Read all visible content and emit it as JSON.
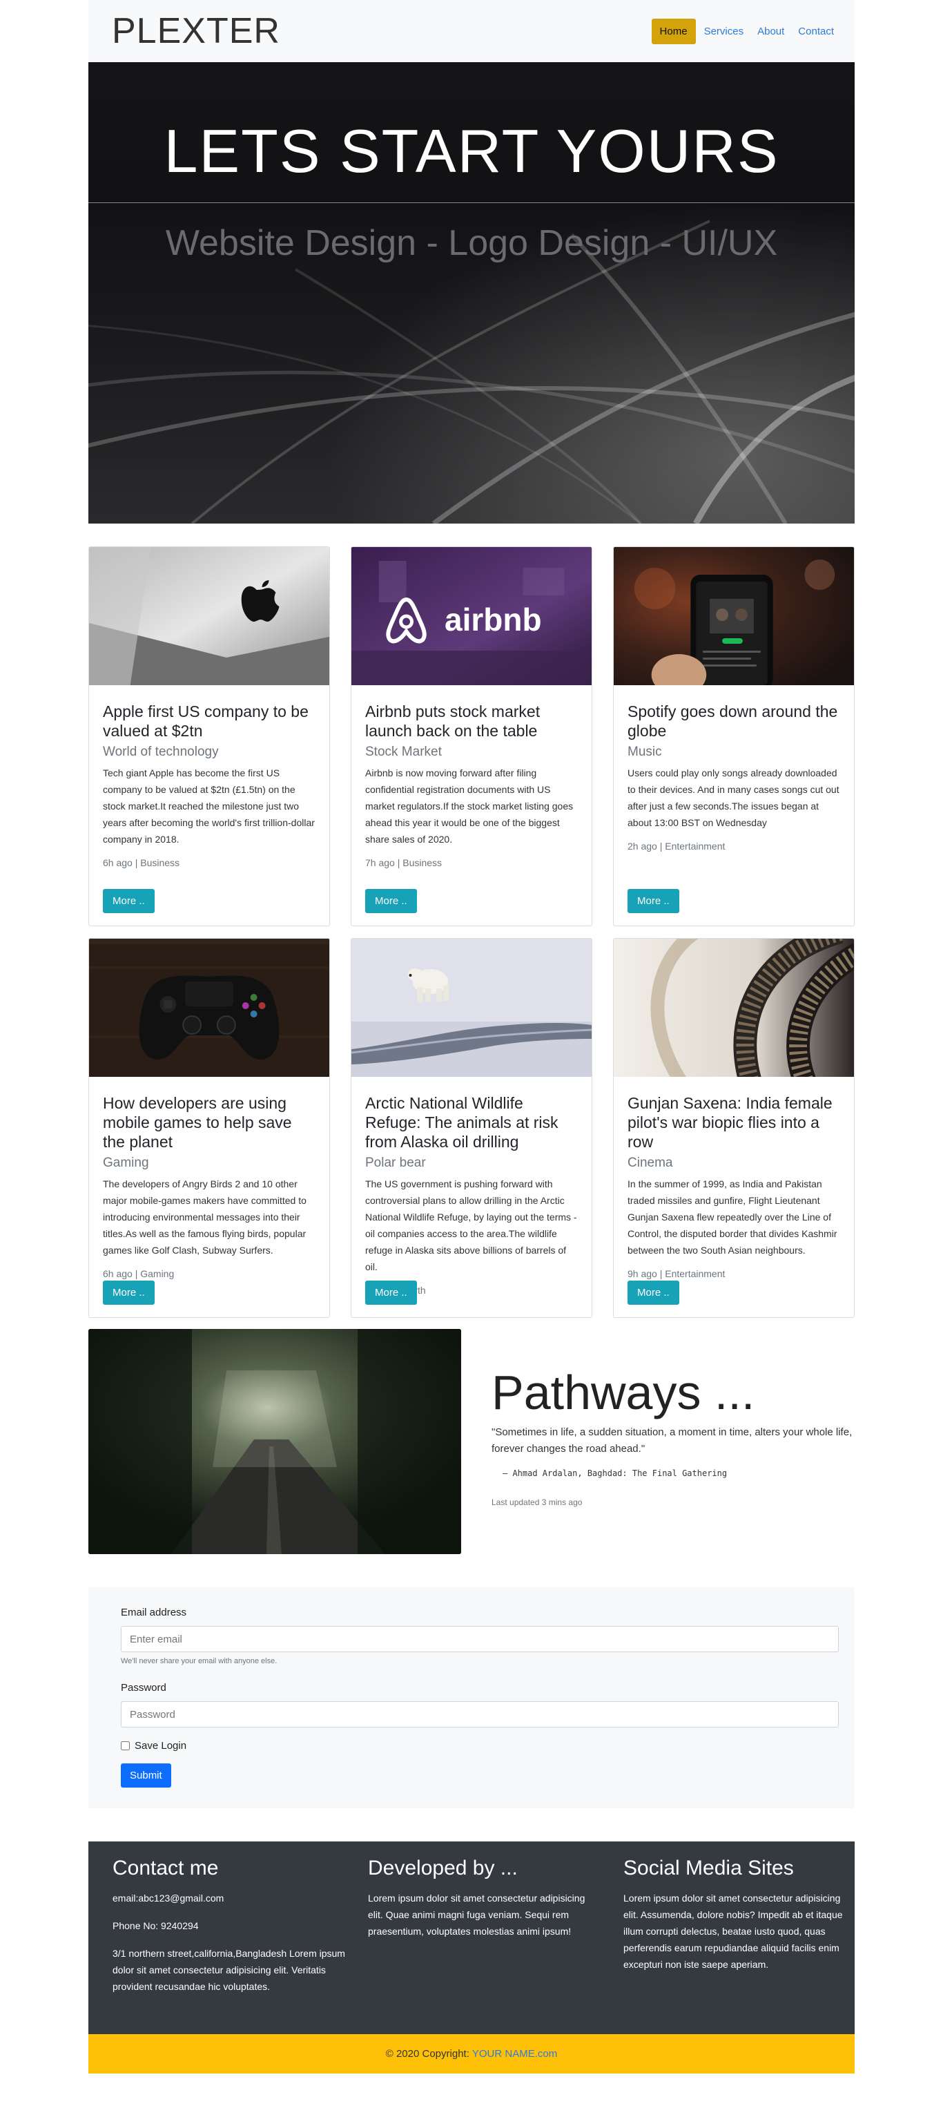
{
  "nav": {
    "brand": "PLEXTER",
    "items": [
      "Home",
      "Services",
      "About",
      "Contact"
    ]
  },
  "hero": {
    "title": "LETS START YOURS",
    "subtitle": "Website Design - Logo Design - UI/UX"
  },
  "cards": [
    {
      "title": "Apple first US company to be valued at $2tn",
      "subtitle": "World of technology",
      "text": "Tech giant Apple has become the first US company to be valued at $2tn (£1.5tn) on the stock market.It reached the milestone just two years after becoming the world's first trillion-dollar company in 2018.",
      "meta": "6h ago | Business",
      "button": "More ..",
      "image": "apple-imac-photo"
    },
    {
      "title": "Airbnb puts stock market launch back on the table",
      "subtitle": "Stock Market",
      "text": "Airbnb is now moving forward after filing confidential registration documents with US market regulators.If the stock market listing goes ahead this year it would be one of the biggest share sales of 2020.",
      "meta": "7h ago | Business",
      "button": "More ..",
      "image": "airbnb-logo-photo",
      "logo_text": "airbnb"
    },
    {
      "title": "Spotify goes down around the globe",
      "subtitle": "Music",
      "text": "Users could play only songs already downloaded to their devices. And in many cases songs cut out after just a few seconds.The issues began at about 13:00 BST on Wednesday",
      "meta": "2h ago | Entertainment",
      "button": "More ..",
      "image": "spotify-phone-photo"
    },
    {
      "title": "How developers are using mobile games to help save the planet",
      "subtitle": "Gaming",
      "text": "The developers of Angry Birds 2 and 10 other major mobile-games makers have committed to introducing environmental messages into their titles.As well as the famous flying birds, popular games like Golf Clash, Subway Surfers.",
      "meta": "6h ago | Gaming",
      "button": "More ..",
      "image": "game-controller-photo"
    },
    {
      "title": "Arctic National Wildlife Refuge: The animals at risk from Alaska oil drilling",
      "subtitle": "Polar bear",
      "text": "The US government is pushing forward with controversial plans to allow drilling in the Arctic National Wildlife Refuge, by laying out the terms -oil companies access to the area.The wildlife refuge in Alaska sits above billions of barrels of oil.",
      "meta": "1h ago | Earth",
      "button": "More ..",
      "image": "polar-bear-photo"
    },
    {
      "title": "Gunjan Saxena: India female pilot's war biopic flies into a row",
      "subtitle": "Cinema",
      "text": "In the summer of 1999, as India and Pakistan traded missiles and gunfire, Flight Lieutenant Gunjan Saxena flew repeatedly over the Line of Control, the disputed border that divides Kashmir between the two South Asian neighbours.",
      "meta": "9h ago | Entertainment",
      "button": "More ..",
      "image": "film-reel-photo"
    }
  ],
  "pathways": {
    "title": "Pathways ...",
    "quote": "\"Sometimes in life, a sudden situation, a moment in time, alters your whole life, forever changes the road ahead.\"",
    "cite": "— Ahmad Ardalan, Baghdad: The Final Gathering",
    "updated": "Last updated 3 mins ago",
    "image": "forest-road-photo"
  },
  "form": {
    "email_label": "Email address",
    "email_placeholder": "Enter email",
    "email_hint": "We'll never share your email with anyone else.",
    "password_label": "Password",
    "password_placeholder": "Password",
    "save_label": "Save Login",
    "submit": "Submit"
  },
  "footer": {
    "contact": {
      "heading": "Contact me",
      "email": "email:abc123@gmail.com",
      "phone": "Phone No: 9240294",
      "address": "3/1 northern street,california,Bangladesh Lorem ipsum dolor sit amet consectetur adipisicing elit. Veritatis provident recusandae hic voluptates."
    },
    "developed": {
      "heading": "Developed by ...",
      "text": "Lorem ipsum dolor sit amet consectetur adipisicing elit. Quae animi magni fuga veniam. Sequi rem praesentium, voluptates molestias animi ipsum!"
    },
    "social": {
      "heading": "Social Media Sites",
      "text": "Lorem ipsum dolor sit amet consectetur adipisicing elit. Assumenda, dolore nobis? Impedit ab et itaque illum corrupti delectus, beatae iusto quod, quas perferendis earum repudiandae aliquid facilis enim excepturi non iste saepe aperiam."
    },
    "copyright": "© 2020 Copyright:",
    "copyright_link": "YOUR NAME.com"
  },
  "colors": {
    "accent_home": "#d4a20a",
    "button_info": "#17a2b8",
    "button_primary": "#0d6efd",
    "footer_bg": "#343a40",
    "copyright_bg": "#ffc107"
  }
}
